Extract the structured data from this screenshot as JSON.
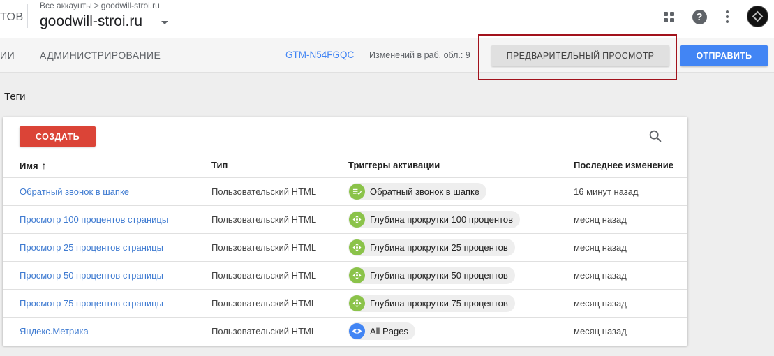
{
  "header": {
    "brand_fragment": "ТОВ",
    "breadcrumb_all": "Все аккаунты",
    "breadcrumb_sep": ">",
    "breadcrumb_account": "goodwill-stroi.ru",
    "container_name": "goodwill-stroi.ru",
    "icons": [
      "apps-icon",
      "help-icon",
      "more-vert-icon",
      "avatar"
    ],
    "help_glyph": "?"
  },
  "nav": {
    "fragment": "ИИ",
    "admin": "АДМИНИСТРИРОВАНИЕ",
    "container_id": "GTM-N54FGQC",
    "changes": "Изменений в раб. обл.: 9",
    "preview_button": "ПРЕДВАРИТЕЛЬНЫЙ ПРОСМОТР",
    "submit_button": "ОТПРАВИТЬ"
  },
  "page": {
    "title": "Теги"
  },
  "toolbar": {
    "create_button": "СОЗДАТЬ"
  },
  "table": {
    "columns": [
      "Имя",
      "Тип",
      "Триггеры активации",
      "Последнее изменение"
    ],
    "sort_arrow": "↑",
    "rows": [
      {
        "name": "Обратный звонок в шапке",
        "type": "Пользовательский HTML",
        "trigger": "Обратный звонок в шапке",
        "trigger_kind": "form",
        "modified": "16 минут назад"
      },
      {
        "name": "Просмотр 100 процентов страницы",
        "type": "Пользовательский HTML",
        "trigger": "Глубина прокрутки 100 процентов",
        "trigger_kind": "scroll",
        "modified": "месяц назад"
      },
      {
        "name": "Просмотр 25 процентов страницы",
        "type": "Пользовательский HTML",
        "trigger": "Глубина прокрутки 25 процентов",
        "trigger_kind": "scroll",
        "modified": "месяц назад"
      },
      {
        "name": "Просмотр 50 процентов страницы",
        "type": "Пользовательский HTML",
        "trigger": "Глубина прокрутки 50 процентов",
        "trigger_kind": "scroll",
        "modified": "месяц назад"
      },
      {
        "name": "Просмотр 75 процентов страницы",
        "type": "Пользовательский HTML",
        "trigger": "Глубина прокрутки 75 процентов",
        "trigger_kind": "scroll",
        "modified": "месяц назад"
      },
      {
        "name": "Яндекс.Метрика",
        "type": "Пользовательский HTML",
        "trigger": "All Pages",
        "trigger_kind": "pageview",
        "modified": "месяц назад"
      }
    ]
  },
  "colors": {
    "accent_blue": "#4285f4",
    "link_blue": "#3f7bd1",
    "create_red": "#db4437",
    "trigger_green": "#8bc34a",
    "pageview_blue": "#4285f4",
    "highlight_red": "#a2121c"
  }
}
